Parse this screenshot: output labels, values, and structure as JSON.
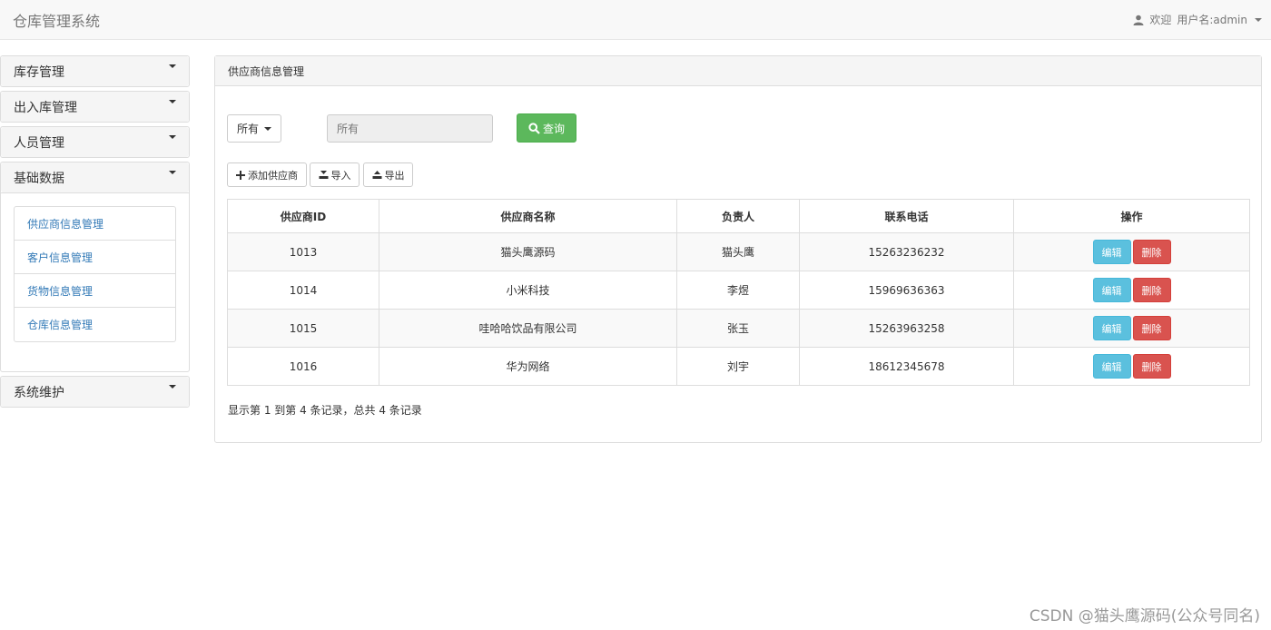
{
  "navbar": {
    "brand": "仓库管理系统",
    "welcome": "欢迎",
    "username_label": "用户名:admin"
  },
  "sidebar": {
    "menus": [
      {
        "label": "库存管理"
      },
      {
        "label": "出入库管理"
      },
      {
        "label": "人员管理"
      },
      {
        "label": "基础数据",
        "expanded": true,
        "items": [
          "供应商信息管理",
          "客户信息管理",
          "货物信息管理",
          "仓库信息管理"
        ]
      },
      {
        "label": "系统维护"
      }
    ]
  },
  "main": {
    "panel_title": "供应商信息管理",
    "filter": {
      "selected": "所有"
    },
    "search": {
      "placeholder": "所有"
    },
    "query_label": "查询",
    "toolbar": {
      "add_label": "添加供应商",
      "import_label": "导入",
      "export_label": "导出"
    },
    "table": {
      "columns": [
        "供应商ID",
        "供应商名称",
        "负责人",
        "联系电话",
        "操作"
      ],
      "rows": [
        {
          "id": "1013",
          "name": "猫头鹰源码",
          "person": "猫头鹰",
          "phone": "15263236232"
        },
        {
          "id": "1014",
          "name": "小米科技",
          "person": "李煜",
          "phone": "15969636363"
        },
        {
          "id": "1015",
          "name": "哇哈哈饮品有限公司",
          "person": "张玉",
          "phone": "15263963258"
        },
        {
          "id": "1016",
          "name": "华为网络",
          "person": "刘宇",
          "phone": "18612345678"
        }
      ],
      "edit_label": "编辑",
      "delete_label": "删除"
    },
    "pager_text": "显示第 1 到第 4 条记录，总共 4 条记录"
  },
  "watermark": "CSDN @猫头鹰源码(公众号同名)",
  "colors": {
    "success": "#5cb85c",
    "info": "#5bc0de",
    "danger": "#d9534f",
    "link": "#337ab7"
  }
}
